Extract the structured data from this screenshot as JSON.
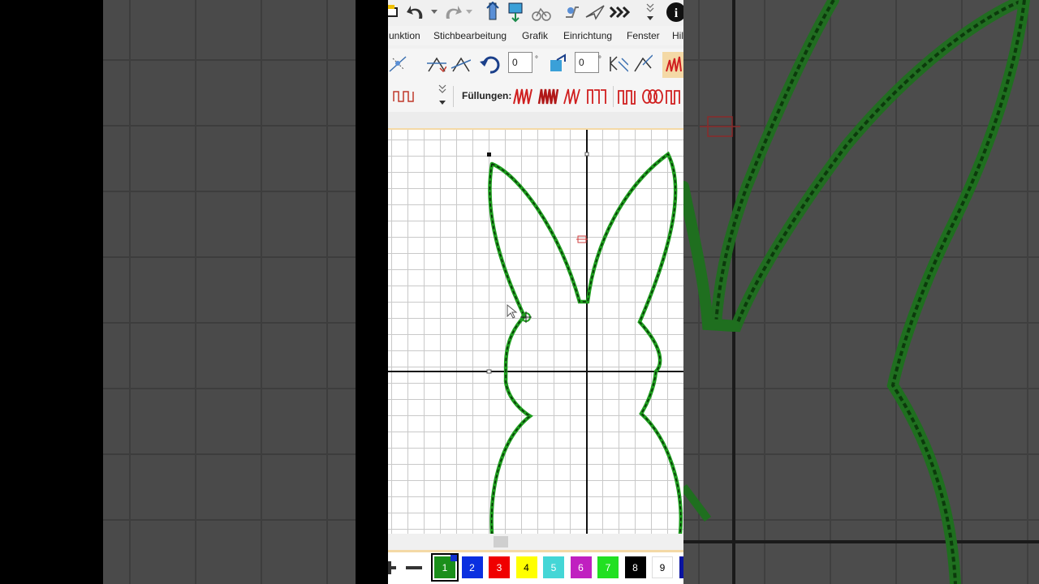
{
  "menu": {
    "items": [
      "unktion",
      "Stichbearbeitung",
      "Grafik",
      "Einrichtung",
      "Fenster",
      "Hil"
    ]
  },
  "toolbar": {
    "rotate_value": "0",
    "mirror_value": "0",
    "degree_symbol": "°"
  },
  "fills": {
    "label": "Füllungen:"
  },
  "colors": {
    "swatches": [
      {
        "label": "1",
        "color": "#1a8f1a",
        "text": "#ffffff"
      },
      {
        "label": "2",
        "color": "#0a2fe0",
        "text": "#ffffff"
      },
      {
        "label": "3",
        "color": "#f00000",
        "text": "#ffffff"
      },
      {
        "label": "4",
        "color": "#ffff00",
        "text": "#000000"
      },
      {
        "label": "5",
        "color": "#44d6d6",
        "text": "#ffffff"
      },
      {
        "label": "6",
        "color": "#c020c0",
        "text": "#ffffff"
      },
      {
        "label": "7",
        "color": "#22e022",
        "text": "#ffffff"
      },
      {
        "label": "8",
        "color": "#000000",
        "text": "#ffffff"
      },
      {
        "label": "9",
        "color": "#ffffff",
        "text": "#000000"
      }
    ],
    "stitch_color": "#1e9e1e",
    "accent_red": "#c0392b"
  },
  "icons": {
    "quick": [
      "print-icon",
      "undo-icon",
      "redo-icon",
      "stitch-up-icon",
      "image-icon",
      "bike-icon",
      "sew-icon",
      "send-icon",
      "fast-forward-icon",
      "more-icon",
      "info-icon"
    ]
  }
}
